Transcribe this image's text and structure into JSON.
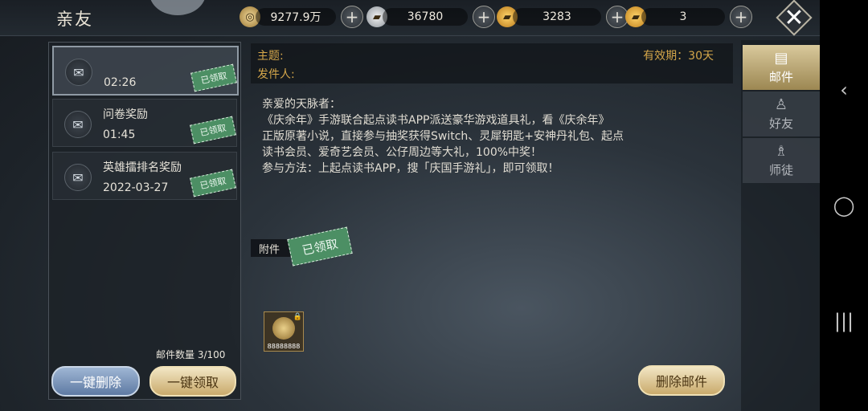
{
  "header": {
    "title": "亲友"
  },
  "currencies": [
    {
      "icon": "copper-coin-icon",
      "value": "9277.9万"
    },
    {
      "icon": "silver-ingot-icon",
      "value": "36780"
    },
    {
      "icon": "locked-gold-ingot-icon",
      "value": "3283"
    },
    {
      "icon": "gold-ingot-icon",
      "value": "3"
    }
  ],
  "mail_list": [
    {
      "subject": "",
      "time": "02:26",
      "status": "已领取"
    },
    {
      "subject": "问卷奖励",
      "time": "01:45",
      "status": "已领取"
    },
    {
      "subject": "英雄擂排名奖励",
      "time": "2022-03-27",
      "status": "已领取"
    }
  ],
  "mail_count": "邮件数量 3/100",
  "buttons": {
    "delete_all": "一键删除",
    "claim_all": "一键领取",
    "delete_mail": "删除邮件"
  },
  "detail": {
    "subject_label": "主题:",
    "sender_label": "发件人:",
    "validity": "有效期：30天",
    "body": [
      "亲爱的天脉者：",
      "《庆余年》手游联合起点读书APP派送豪华游戏道具礼，看《庆余年》",
      "正版原著小说，直接参与抽奖获得Switch、灵犀钥匙+安神丹礼包、起点",
      "读书会员、爱奇艺会员、公仔周边等大礼，100%中奖！",
      "参与方法：上起点读书APP，搜「庆国手游礼」，即可领取！"
    ],
    "attachment_label": "附件",
    "attachment_status": "已领取",
    "attachment_item": {
      "icon": "copper-coin-icon",
      "quantity": "88888888"
    }
  },
  "tabs": [
    {
      "label": "邮件",
      "active": true
    },
    {
      "label": "好友",
      "active": false
    },
    {
      "label": "师徒",
      "active": false
    }
  ],
  "colors": {
    "accent_gold": "#d4a64a",
    "claimed_green": "#4c8f64"
  }
}
